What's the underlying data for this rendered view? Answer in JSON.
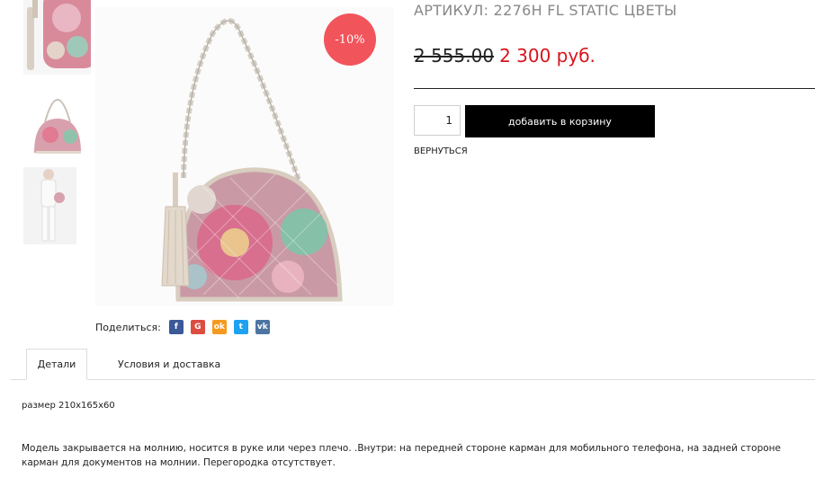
{
  "product": {
    "article_title": "АРТИКУЛ: 2276H FL STATIC ЦВЕТЫ",
    "old_price": "2 555.00",
    "new_price": "2 300 руб.",
    "discount_badge": "-10%"
  },
  "cart": {
    "quantity": "1",
    "add_to_cart_label": "добавить в корзину",
    "back_label": "ВЕРНУТЬСЯ"
  },
  "share": {
    "label": "Поделиться:",
    "networks": [
      {
        "icon": "facebook-icon",
        "glyph": "f",
        "color": "#3b5998"
      },
      {
        "icon": "google-plus-icon",
        "glyph": "G",
        "color": "#dc4e41"
      },
      {
        "icon": "odnoklassniki-icon",
        "glyph": "ok",
        "color": "#f59a1f"
      },
      {
        "icon": "twitter-icon",
        "glyph": "t",
        "color": "#1da1f2"
      },
      {
        "icon": "vk-icon",
        "glyph": "vk",
        "color": "#4c75a3"
      }
    ]
  },
  "tabs": [
    {
      "label": "Детали",
      "active": true
    },
    {
      "label": "Условия и доставка",
      "active": false
    }
  ],
  "description": {
    "size": "размер 210x165x60",
    "text": "Модель закрывается на молнию,  носится в руке или через плечо. .Внутри: на передней стороне карман для мобильного телефона, на задней стороне карман для документов на молнии. Перегородка отсутствует."
  },
  "colors": {
    "badge": "#f2545b",
    "new_price": "#d8141a",
    "button": "#000000"
  }
}
